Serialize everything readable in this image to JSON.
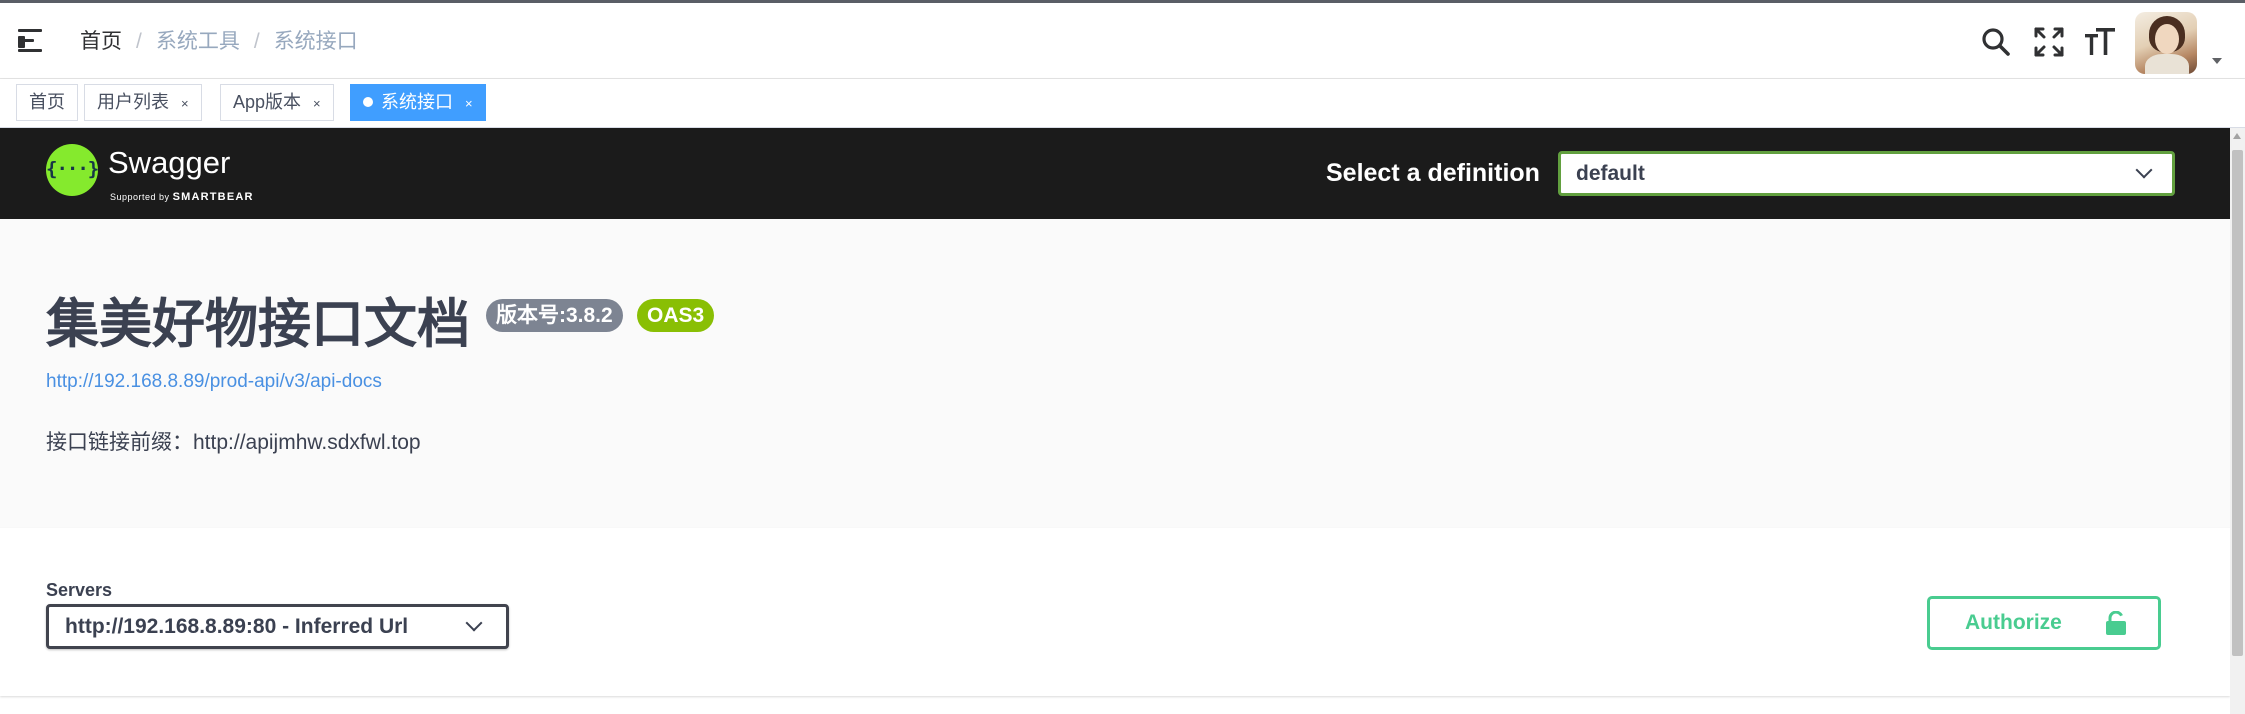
{
  "navbar": {
    "breadcrumb": [
      "首页",
      "系统工具",
      "系统接口"
    ]
  },
  "tags": [
    {
      "label": "首页",
      "closable": false,
      "active": false
    },
    {
      "label": "用户列表",
      "closable": true,
      "active": false
    },
    {
      "label": "App版本",
      "closable": true,
      "active": false
    },
    {
      "label": "系统接口",
      "closable": true,
      "active": true
    }
  ],
  "tag_close": "×",
  "swagger": {
    "brand": "Swagger",
    "supported_by": "Supported by",
    "supported_brand": "SMARTBEAR",
    "logo_glyph": "{···}",
    "definition_label": "Select a definition",
    "definition_value": "default"
  },
  "info": {
    "title": "集美好物接口文档",
    "version_badge": "版本号:3.8.2",
    "oas_badge": "OAS3",
    "url": "http://192.168.8.89/prod-api/v3/api-docs",
    "description": "接口链接前缀：http://apijmhw.sdxfwl.top"
  },
  "servers": {
    "label": "Servers",
    "selected": "http://192.168.8.89:80 - Inferred Url"
  },
  "authorize": {
    "label": "Authorize"
  },
  "icons": [
    "hamburger-icon",
    "search-icon",
    "fullscreen-icon",
    "font-size-icon",
    "chevron-down-icon",
    "lock-icon"
  ],
  "colors": {
    "active_tag": "#409eff",
    "swagger_green": "#85ea2d",
    "definition_border": "#62a03f",
    "authorize_green": "#49cc90",
    "link": "#4990e2",
    "version_badge": "#7d8492",
    "oas_badge": "#89bf04"
  }
}
